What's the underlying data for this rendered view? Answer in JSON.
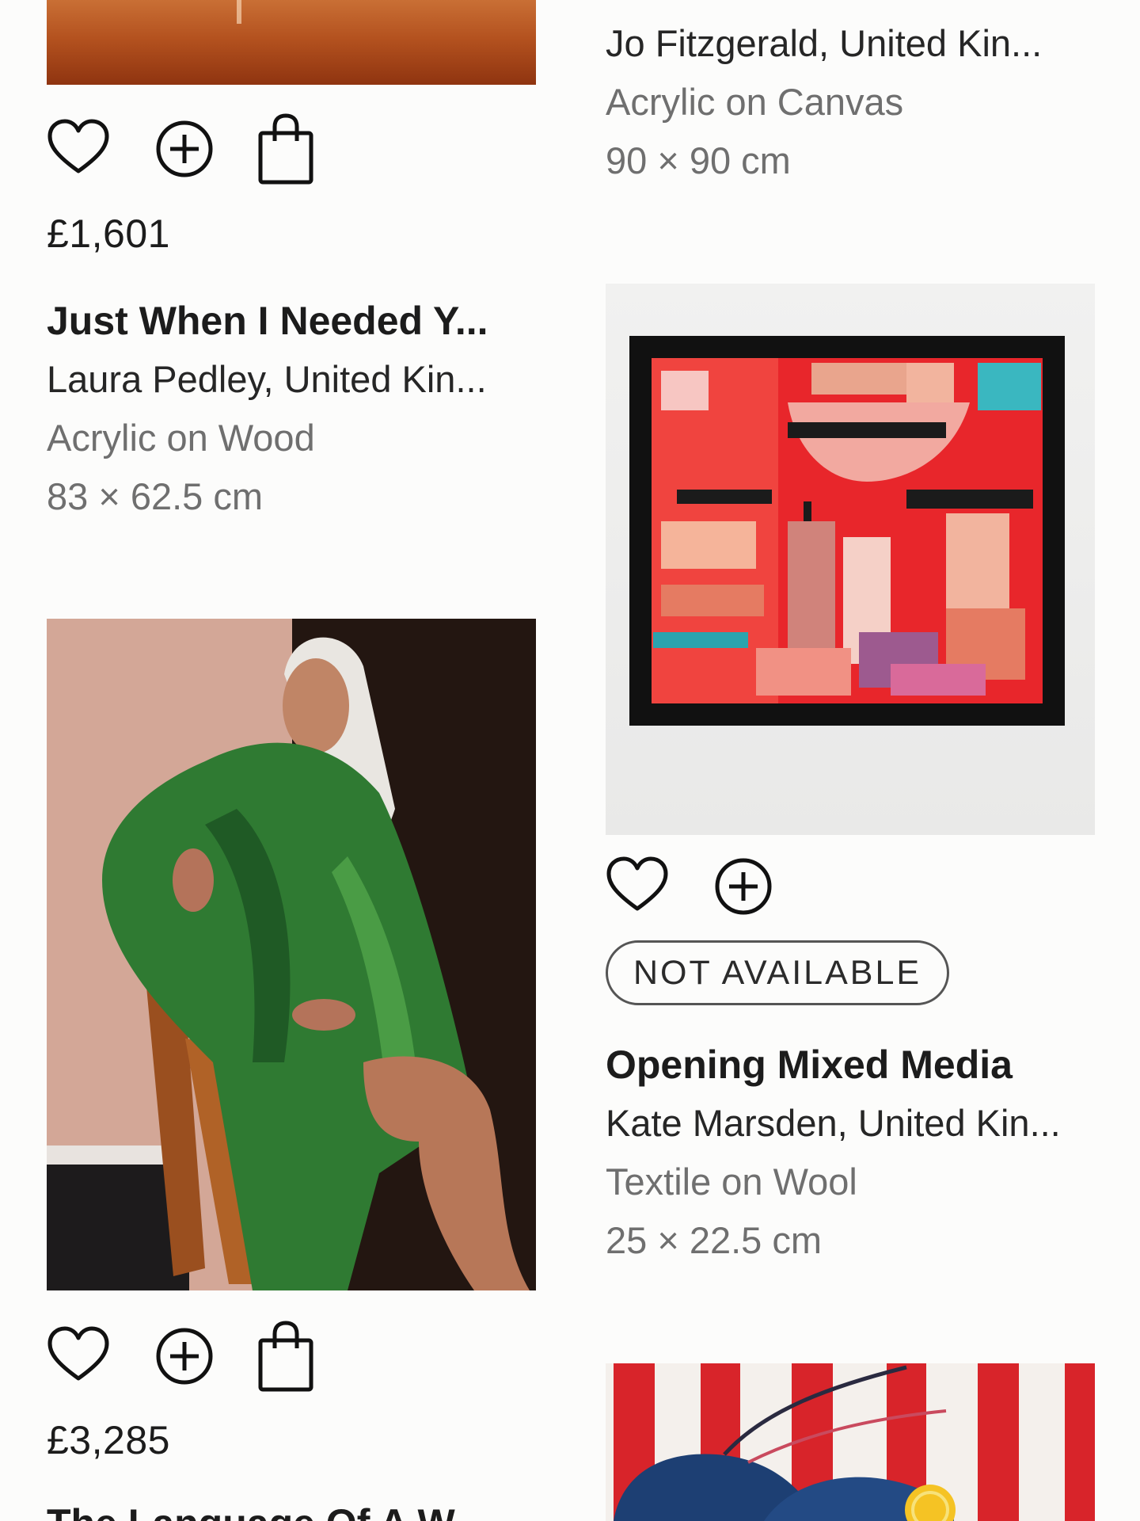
{
  "cards": [
    {
      "image_alt": "sunset painting",
      "price": "£1,601",
      "title": "Just When I Needed Y...",
      "artist": "Laura Pedley, United Kin...",
      "medium": "Acrylic on Wood",
      "size": "83 × 62.5 cm"
    },
    {
      "title": "",
      "artist": "Jo Fitzgerald, United Kin...",
      "medium": "Acrylic on Canvas",
      "size": "90 × 90 cm"
    },
    {
      "image_alt": "woman in green robe painting",
      "price": "£3,285",
      "title": "The Language Of A W...",
      "artist": "",
      "medium": "",
      "size": ""
    },
    {
      "image_alt": "red geometric textile artwork",
      "status": "NOT AVAILABLE",
      "title": "Opening Mixed Media",
      "artist": "Kate Marsden, United Kin...",
      "medium": "Textile on Wool",
      "size": "25 × 22.5 cm"
    },
    {
      "image_alt": "lobster painting with red stripes"
    }
  ],
  "icons": [
    "heart-icon",
    "add-circle-icon",
    "shopping-bag-icon"
  ],
  "colors": {
    "background": "#fcfcfb",
    "text": "#1c1c1c",
    "muted": "#6f6f6f"
  }
}
